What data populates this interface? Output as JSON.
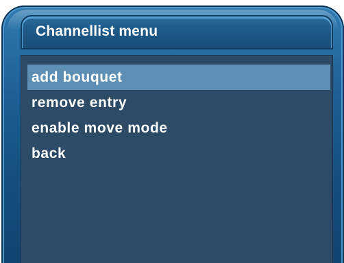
{
  "window": {
    "title": "Channellist menu"
  },
  "menu": {
    "selected_index": 0,
    "items": [
      {
        "label": "add bouquet"
      },
      {
        "label": "remove entry"
      },
      {
        "label": "enable move mode"
      },
      {
        "label": "back"
      }
    ]
  },
  "colors": {
    "bezel": "#1c5f96",
    "panel": "#2d4a66",
    "highlight": "#5c8fb3",
    "text": "#ffffff"
  }
}
